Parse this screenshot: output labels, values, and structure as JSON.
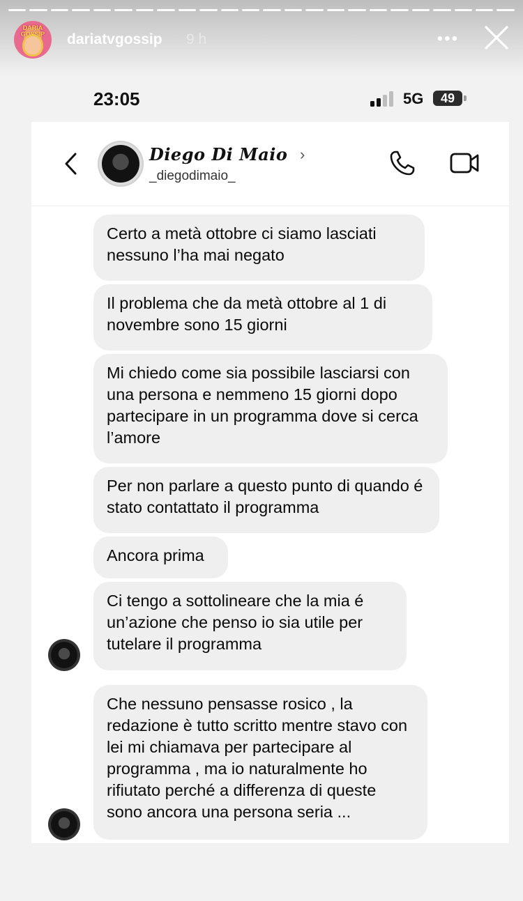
{
  "story": {
    "username": "dariatvgossip",
    "time_ago": "9 h",
    "avatar_text": "DARIA GOSSIP",
    "more_icon": "more-dots-icon",
    "close_icon": "close-icon"
  },
  "status_bar": {
    "time": "23:05",
    "network": "5G",
    "battery": "49"
  },
  "chat_header": {
    "name": "Diego Di Maio",
    "handle": "_diegodimaio_"
  },
  "messages": [
    {
      "text": "Certo a metà ottobre ci siamo lasciati nessuno l’ha mai negato"
    },
    {
      "text": "Il problema che da metà ottobre al 1 di novembre sono 15 giorni"
    },
    {
      "text": "Mi chiedo come sia possibile lasciarsi con una persona e nemmeno 15 giorni dopo partecipare in un programma dove si cerca l’amore"
    },
    {
      "text": "Per non parlare a questo punto di quando é stato contattato il programma"
    },
    {
      "text": "Ancora prima"
    },
    {
      "text": "Ci tengo a sottolineare che la mia é un’azione che penso io sia utile per tutelare il programma"
    },
    {
      "text": "Che nessuno pensasse rosico , la redazione è tutto scritto mentre stavo con lei mi chiamava per partecipare al programma , ma io naturalmente ho rifiutato perché a differenza di queste sono ancora una persona seria ..."
    }
  ]
}
